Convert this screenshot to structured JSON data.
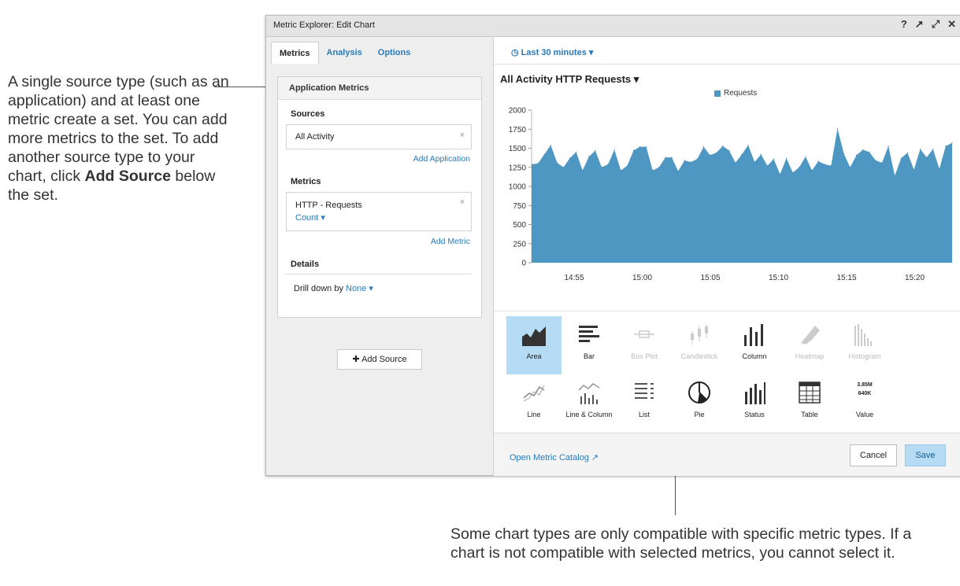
{
  "callouts": {
    "left_text": "A single source type (such as an application) and at least one metric create a set. You can add more metrics to the set. To add another source type to your chart, click",
    "left_bold_1": "Add",
    "left_bold_2": "Source",
    "left_end": "below the set.",
    "bottom": "Some chart types are only compatible with specific metric types. If a chart is not compatible with selected metrics, you cannot select it."
  },
  "dialog": {
    "title": "Metric Explorer: Edit Chart",
    "controls": [
      "?",
      "↗",
      "⤢",
      "✕"
    ]
  },
  "left": {
    "tabs": [
      "Metrics",
      "Analysis",
      "Options"
    ],
    "panel_title": "Application Metrics",
    "sources_label": "Sources",
    "source_value": "All Activity",
    "add_application": "Add Application",
    "metrics_label": "Metrics",
    "metric_name": "HTTP - Requests",
    "metric_agg": "Count ▾",
    "add_metric": "Add Metric",
    "details_label": "Details",
    "drill_label": "Drill down by",
    "drill_value": "None ▾",
    "add_source": "✚ Add Source",
    "remove": "×"
  },
  "right": {
    "time_range": "Last 30 minutes",
    "chart_title": "All Activity HTTP Requests ▾",
    "legend": "Requests",
    "open_catalog": "Open Metric Catalog ↗",
    "cancel": "Cancel",
    "save": "Save"
  },
  "chart_types": [
    {
      "label": "Area",
      "icon": "area-chart-icon",
      "state": "selected"
    },
    {
      "label": "Bar",
      "icon": "bar-chart-icon",
      "state": "enabled"
    },
    {
      "label": "Box Plot",
      "icon": "box-plot-icon",
      "state": "disabled"
    },
    {
      "label": "Candlestick",
      "icon": "candlestick-icon",
      "state": "disabled"
    },
    {
      "label": "Column",
      "icon": "column-chart-icon",
      "state": "enabled"
    },
    {
      "label": "Heatmap",
      "icon": "heatmap-icon",
      "state": "disabled"
    },
    {
      "label": "Histogram",
      "icon": "histogram-icon",
      "state": "disabled"
    },
    {
      "label": "Line",
      "icon": "line-chart-icon",
      "state": "enabled"
    },
    {
      "label": "Line & Column",
      "icon": "line-column-icon",
      "state": "enabled"
    },
    {
      "label": "List",
      "icon": "list-icon",
      "state": "enabled"
    },
    {
      "label": "Pie",
      "icon": "pie-chart-icon",
      "state": "enabled"
    },
    {
      "label": "Status",
      "icon": "status-icon",
      "state": "enabled"
    },
    {
      "label": "Table",
      "icon": "table-icon",
      "state": "enabled"
    },
    {
      "label": "Value",
      "icon": "value-icon",
      "state": "enabled"
    }
  ],
  "value_icon_text": [
    "3.85M",
    "640K"
  ],
  "colors": {
    "series": "#4e97c2",
    "accent": "#2a7ab9",
    "selected": "#b6dbf4"
  },
  "chart_data": {
    "type": "area",
    "title": "All Activity HTTP Requests",
    "series": [
      {
        "name": "Requests",
        "values": [
          1290,
          1300,
          1420,
          1540,
          1310,
          1250,
          1370,
          1450,
          1210,
          1390,
          1470,
          1250,
          1290,
          1480,
          1210,
          1270,
          1470,
          1520,
          1520,
          1210,
          1250,
          1380,
          1380,
          1200,
          1340,
          1320,
          1360,
          1520,
          1410,
          1440,
          1530,
          1470,
          1310,
          1420,
          1540,
          1320,
          1420,
          1270,
          1360,
          1160,
          1370,
          1180,
          1250,
          1390,
          1210,
          1330,
          1290,
          1270,
          1760,
          1430,
          1250,
          1410,
          1480,
          1450,
          1340,
          1310,
          1530,
          1140,
          1370,
          1440,
          1220,
          1490,
          1380,
          1490,
          1230,
          1530,
          1570
        ]
      }
    ],
    "yticks": [
      0,
      250,
      500,
      750,
      1000,
      1250,
      1500,
      1750,
      2000
    ],
    "xticks": [
      "14:55",
      "15:00",
      "15:05",
      "15:10",
      "15:15",
      "15:20"
    ],
    "ylim": [
      0,
      2000
    ],
    "grid": false,
    "legend": "top-center"
  }
}
